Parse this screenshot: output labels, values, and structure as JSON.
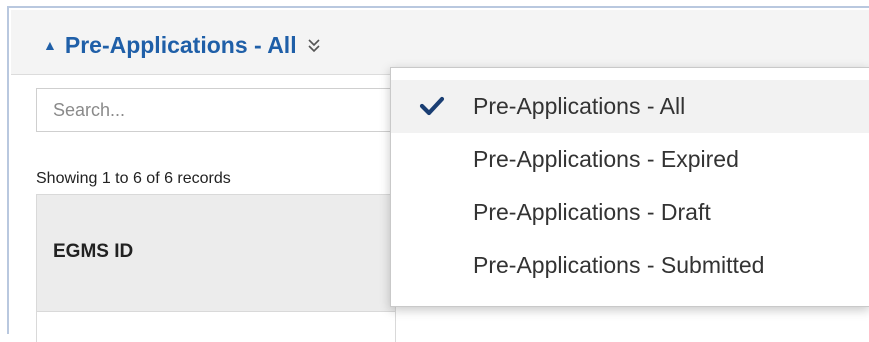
{
  "header": {
    "title": "Pre-Applications - All",
    "caret_icon": "caret-up-icon",
    "toggle_icon": "double-chevron-down-icon"
  },
  "search": {
    "placeholder": "Search...",
    "value": ""
  },
  "records_info": "Showing 1 to 6 of 6 records",
  "table": {
    "columns": [
      "EGMS ID"
    ]
  },
  "dropdown": {
    "items": [
      {
        "label": "Pre-Applications - All",
        "selected": true
      },
      {
        "label": "Pre-Applications - Expired",
        "selected": false
      },
      {
        "label": "Pre-Applications - Draft",
        "selected": false
      },
      {
        "label": "Pre-Applications - Submitted",
        "selected": false
      }
    ]
  },
  "colors": {
    "title": "#1f5fa8",
    "panel_border": "#b9c8df",
    "check": "#1a3e73"
  }
}
